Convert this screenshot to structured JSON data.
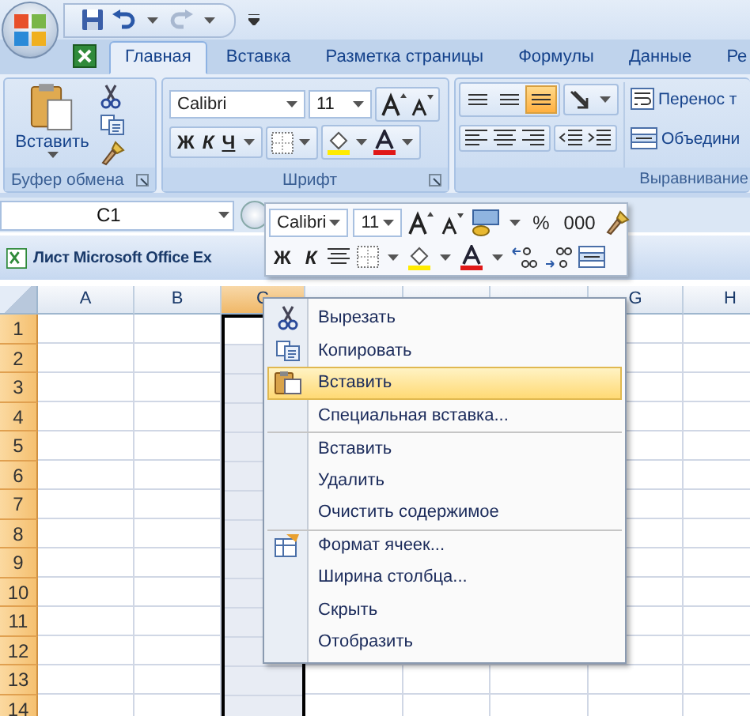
{
  "tabs": [
    {
      "label": "Главная",
      "selected": true
    },
    {
      "label": "Вставка",
      "selected": false
    },
    {
      "label": "Разметка страницы",
      "selected": false
    },
    {
      "label": "Формулы",
      "selected": false
    },
    {
      "label": "Данные",
      "selected": false
    },
    {
      "label": "Ре",
      "selected": false
    }
  ],
  "ribbon": {
    "clipboard": {
      "label": "Буфер обмена",
      "paste": "Вставить"
    },
    "font": {
      "label": "Шрифт",
      "name": "Calibri",
      "size": "11",
      "bold": "Ж",
      "italic": "К",
      "underline": "Ч"
    },
    "alignment": {
      "label": "Выравнивание",
      "vertical_align": [
        {
          "selected": false
        },
        {
          "selected": false
        },
        {
          "selected": true
        }
      ],
      "wrap_text": "Перенос т",
      "merge": "Объедини"
    }
  },
  "name_box": {
    "value": "C1"
  },
  "workbook": {
    "title": "Лист Microsoft Office Ex"
  },
  "columns": [
    {
      "label": "A",
      "selected": false
    },
    {
      "label": "B",
      "selected": false
    },
    {
      "label": "C",
      "selected": true
    },
    {
      "selected": false
    },
    {
      "selected": false
    },
    {
      "selected": false
    },
    {
      "label": "G",
      "selected": false
    },
    {
      "label": "H",
      "selected": false
    }
  ],
  "rows": [
    "1",
    "2",
    "3",
    "4",
    "5",
    "6",
    "7",
    "8",
    "9",
    "10",
    "11",
    "12",
    "13",
    "14"
  ],
  "mini_toolbar": {
    "font": "Calibri",
    "size": "11",
    "percent": "%",
    "thousands": "000",
    "bold": "Ж",
    "italic": "К"
  },
  "context_menu": [
    {
      "label": "Вырезать",
      "selected": false,
      "separator_before": false
    },
    {
      "label": "Копировать",
      "selected": false,
      "separator_before": false
    },
    {
      "label": "Вставить",
      "selected": true,
      "separator_before": false
    },
    {
      "label": "Специальная вставка...",
      "selected": false,
      "separator_before": false
    },
    {
      "label": "Вставить",
      "selected": false,
      "separator_before": true
    },
    {
      "label": "Удалить",
      "selected": false,
      "separator_before": false
    },
    {
      "label": "Очистить содержимое",
      "selected": false,
      "separator_before": false
    },
    {
      "label": "Формат ячеек...",
      "selected": false,
      "separator_before": true
    },
    {
      "label": "Ширина столбца...",
      "selected": false,
      "separator_before": false
    },
    {
      "label": "Скрыть",
      "selected": false,
      "separator_before": false
    },
    {
      "label": "Отобразить",
      "selected": false,
      "separator_before": false
    }
  ]
}
